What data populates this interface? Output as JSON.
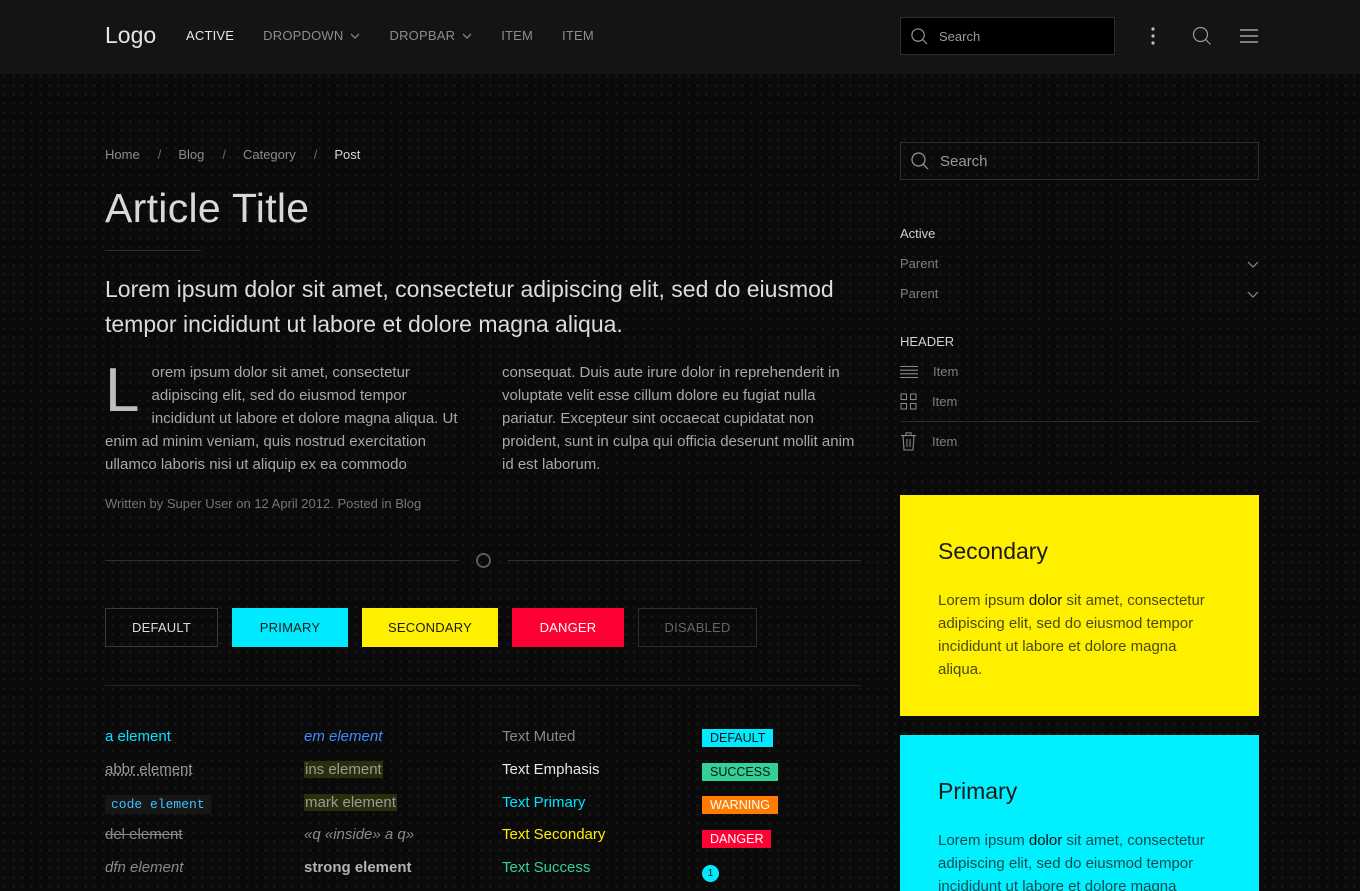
{
  "navbar": {
    "logo": "Logo",
    "items": [
      {
        "label": "ACTIVE"
      },
      {
        "label": "DROPDOWN"
      },
      {
        "label": "DROPBAR"
      },
      {
        "label": "ITEM"
      },
      {
        "label": "ITEM"
      }
    ],
    "search_placeholder": "Search"
  },
  "breadcrumb": [
    "Home",
    "Blog",
    "Category",
    "Post"
  ],
  "article": {
    "title": "Article Title",
    "lead": "Lorem ipsum dolor sit amet, consectetur adipiscing elit, sed do eiusmod tempor incididunt ut labore et dolore magna aliqua.",
    "dropcap": "L",
    "col1": "orem ipsum dolor sit amet, consectetur adipiscing elit, sed do eiusmod tempor incididunt ut labore et dolore magna aliqua. Ut enim ad minim veniam, quis nostrud exercitation ullamco laboris nisi ut aliquip ex ea commodo",
    "col2": "consequat. Duis aute irure dolor in reprehenderit in voluptate velit esse cillum dolore eu fugiat nulla pariatur. Excepteur sint occaecat cupidatat non proident, sunt in culpa qui officia deserunt mollit anim id est laborum.",
    "meta": "Written by Super User on 12 April 2012. Posted in Blog"
  },
  "buttons": {
    "default": "DEFAULT",
    "primary": "PRIMARY",
    "secondary": "SECONDARY",
    "danger": "DANGER",
    "disabled": "DISABLED"
  },
  "elements": {
    "a": "a element",
    "abbr": "abbr element",
    "code": "code element",
    "del": "del element",
    "dfn": "dfn element",
    "em": "em element",
    "ins": "ins element",
    "mark": "mark element",
    "q": "«q «inside» a q»",
    "strong": "strong element"
  },
  "text_styles": {
    "muted": "Text Muted",
    "emphasis": "Text Emphasis",
    "primary": "Text Primary",
    "secondary": "Text Secondary",
    "success": "Text Success"
  },
  "badges": {
    "default": "DEFAULT",
    "success": "SUCCESS",
    "warning": "WARNING",
    "danger": "DANGER",
    "count": "1"
  },
  "sidebar": {
    "search_placeholder": "Search",
    "nav": [
      {
        "label": "Active"
      },
      {
        "label": "Parent"
      },
      {
        "label": "Parent"
      }
    ],
    "header": "HEADER",
    "icon_items": [
      {
        "label": "Item",
        "icon": "list-icon"
      },
      {
        "label": "Item",
        "icon": "grid-icon"
      },
      {
        "label": "Item",
        "icon": "trash-icon"
      }
    ]
  },
  "cards": {
    "secondary": {
      "title": "Secondary",
      "text_before": "Lorem ipsum ",
      "text_strong": "dolor",
      "text_after": " sit amet, consectetur adipiscing elit, sed do eiusmod tempor incididunt ut labore et dolore magna aliqua."
    },
    "primary": {
      "title": "Primary",
      "text_before": "Lorem ipsum ",
      "text_strong": "dolor",
      "text_after": " sit amet, consectetur adipiscing elit, sed do eiusmod tempor incididunt ut labore et dolore magna aliqua."
    }
  },
  "colors": {
    "primary": "#00eaff",
    "secondary": "#fff000",
    "danger": "#ff0033",
    "success": "#32d296",
    "warning": "#ff7c00"
  }
}
